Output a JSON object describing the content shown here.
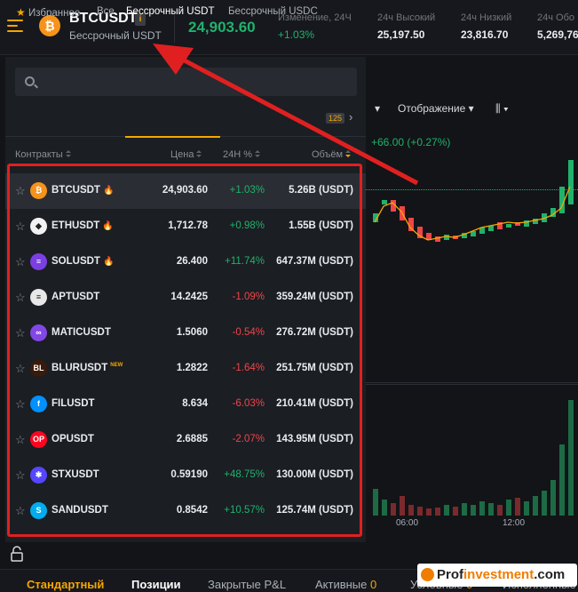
{
  "header": {
    "symbol": "BTCUSDT",
    "info_badge": "i",
    "subtitle": "Бессрочный USDT",
    "last_price": "24,903.60",
    "stats": [
      {
        "label": "Изменение, 24Ч",
        "value": "+1.03%"
      },
      {
        "label": "24ч Высокий",
        "value": "25,197.50"
      },
      {
        "label": "24ч Низкий",
        "value": "23,816.70"
      },
      {
        "label": "24ч Обо",
        "value": "5,269,76"
      }
    ]
  },
  "chart_toolbar": {
    "display_label": "Отображение",
    "change": "+66.00 (+0.27%)",
    "time_labels": [
      "06:00",
      "12:00"
    ]
  },
  "dropdown": {
    "search_placeholder": "",
    "tabs": [
      "Избранное",
      "Все",
      "Бессрочный USDT",
      "Бессрочный USDC"
    ],
    "usdc_count": "125",
    "columns": {
      "contracts": "Контракты",
      "price": "Цена",
      "change": "24Н %",
      "volume": "Объём"
    },
    "rows": [
      {
        "symbol": "BTCUSDT",
        "hot": true,
        "new": false,
        "price": "24,903.60",
        "change": "+1.03%",
        "dir": "up",
        "volume": "5.26B (USDT)",
        "coin_color": "#f7931a",
        "coin_text": "₿"
      },
      {
        "symbol": "ETHUSDT",
        "hot": true,
        "new": false,
        "price": "1,712.78",
        "change": "+0.98%",
        "dir": "up",
        "volume": "1.55B (USDT)",
        "coin_color": "#f2f2f2",
        "coin_text": "◆"
      },
      {
        "symbol": "SOLUSDT",
        "hot": true,
        "new": false,
        "price": "26.400",
        "change": "+11.74%",
        "dir": "up",
        "volume": "647.37M (USDT)",
        "coin_color": "#7b3fe4",
        "coin_text": "≡"
      },
      {
        "symbol": "APTUSDT",
        "hot": false,
        "new": false,
        "price": "14.2425",
        "change": "-1.09%",
        "dir": "dn",
        "volume": "359.24M (USDT)",
        "coin_color": "#e8e8e8",
        "coin_text": "≡"
      },
      {
        "symbol": "MATICUSDT",
        "hot": false,
        "new": false,
        "price": "1.5060",
        "change": "-0.54%",
        "dir": "dn",
        "volume": "276.72M (USDT)",
        "coin_color": "#8247e5",
        "coin_text": "∞"
      },
      {
        "symbol": "BLURUSDT",
        "hot": false,
        "new": true,
        "price": "1.2822",
        "change": "-1.64%",
        "dir": "dn",
        "volume": "251.75M (USDT)",
        "coin_color": "#3a1a0a",
        "coin_text": "BL"
      },
      {
        "symbol": "FILUSDT",
        "hot": false,
        "new": false,
        "price": "8.634",
        "change": "-6.03%",
        "dir": "dn",
        "volume": "210.41M (USDT)",
        "coin_color": "#0090ff",
        "coin_text": "f"
      },
      {
        "symbol": "OPUSDT",
        "hot": false,
        "new": false,
        "price": "2.6885",
        "change": "-2.07%",
        "dir": "dn",
        "volume": "143.95M (USDT)",
        "coin_color": "#ff0420",
        "coin_text": "OP"
      },
      {
        "symbol": "STXUSDT",
        "hot": false,
        "new": false,
        "price": "0.59190",
        "change": "+48.75%",
        "dir": "up",
        "volume": "130.00M (USDT)",
        "coin_color": "#5546ff",
        "coin_text": "✱"
      },
      {
        "symbol": "SANDUSDT",
        "hot": false,
        "new": false,
        "price": "0.8542",
        "change": "+10.57%",
        "dir": "up",
        "volume": "125.74M (USDT)",
        "coin_color": "#00adef",
        "coin_text": "S"
      }
    ],
    "hot_glyph": "🔥",
    "new_label": "NEW"
  },
  "bottom_tabs": [
    {
      "label": "Стандартный"
    },
    {
      "label": "Позиции"
    },
    {
      "label": "Закрытые P&L"
    },
    {
      "label": "Активные",
      "count": "0"
    },
    {
      "label": "Условные",
      "count": "0"
    },
    {
      "label": "Исполненные"
    }
  ],
  "watermark": {
    "pre": "Prof",
    "mid": "investment",
    "post": ".com"
  },
  "colors": {
    "accent": "#f7a600",
    "up": "#20b26c",
    "down": "#ef454a",
    "annotation": "#e02020"
  }
}
